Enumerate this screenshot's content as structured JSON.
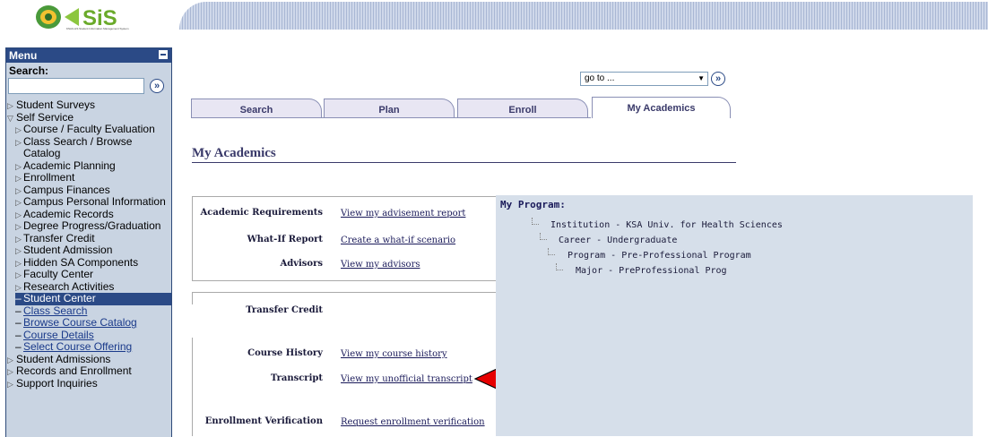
{
  "header": {
    "logo_text": "SiS",
    "logo_subtext": "KSAU-HS Student Information Management System"
  },
  "sidebar": {
    "title": "Menu",
    "search_label": "Search:",
    "search_value": "",
    "items": [
      {
        "label": "Student Surveys",
        "kind": "collapsed"
      },
      {
        "label": "Self Service",
        "kind": "expanded"
      },
      {
        "label": "Course / Faculty Evaluation",
        "kind": "sub"
      },
      {
        "label": "Class Search / Browse Catalog",
        "kind": "sub"
      },
      {
        "label": "Academic Planning",
        "kind": "sub"
      },
      {
        "label": "Enrollment",
        "kind": "sub"
      },
      {
        "label": "Campus Finances",
        "kind": "sub"
      },
      {
        "label": "Campus Personal Information",
        "kind": "sub"
      },
      {
        "label": "Academic Records",
        "kind": "sub"
      },
      {
        "label": "Degree Progress/Graduation",
        "kind": "sub"
      },
      {
        "label": "Transfer Credit",
        "kind": "sub"
      },
      {
        "label": "Student Admission",
        "kind": "sub"
      },
      {
        "label": "Hidden SA Components",
        "kind": "sub"
      },
      {
        "label": "Faculty Center",
        "kind": "sub"
      },
      {
        "label": "Research Activities",
        "kind": "sub"
      },
      {
        "label": "Student Center",
        "kind": "selected"
      },
      {
        "label": "Class Search",
        "kind": "link"
      },
      {
        "label": "Browse Course Catalog",
        "kind": "link"
      },
      {
        "label": "Course Details",
        "kind": "link"
      },
      {
        "label": "Select Course Offering",
        "kind": "link"
      },
      {
        "label": "Student Admissions",
        "kind": "collapsed"
      },
      {
        "label": "Records and Enrollment",
        "kind": "collapsed"
      },
      {
        "label": "Support Inquiries",
        "kind": "collapsed"
      }
    ]
  },
  "goto": {
    "value": "go to ..."
  },
  "tabs": [
    {
      "label": "Search",
      "active": false
    },
    {
      "label": "Plan",
      "active": false
    },
    {
      "label": "Enroll",
      "active": false
    },
    {
      "label": "My Academics",
      "active": true
    }
  ],
  "page_title": "My Academics",
  "sections": {
    "academic_requirements": {
      "label": "Academic Requirements",
      "link": "View my advisement report"
    },
    "what_if": {
      "label": "What-If Report",
      "link": "Create a what-if scenario"
    },
    "advisors": {
      "label": "Advisors",
      "link": "View my advisors"
    },
    "transfer_credit": {
      "label": "Transfer Credit"
    },
    "course_history": {
      "label": "Course History",
      "link": "View my course history"
    },
    "transcript": {
      "label": "Transcript",
      "link": "View my unofficial transcript"
    },
    "enrollment_verification": {
      "label": "Enrollment Verification",
      "link": "Request enrollment verification"
    }
  },
  "program": {
    "title": "My Program:",
    "lines": [
      "Institution - KSA Univ. for Health Sciences",
      "Career - Undergraduate",
      "Program - Pre-Professional Program",
      "Major - PreProfessional Prog"
    ]
  },
  "colors": {
    "menu_header": "#2b4a86",
    "sidebar_bg": "#c9d4e2",
    "program_bg": "#d6dfea",
    "arrow_red": "#e60000"
  }
}
